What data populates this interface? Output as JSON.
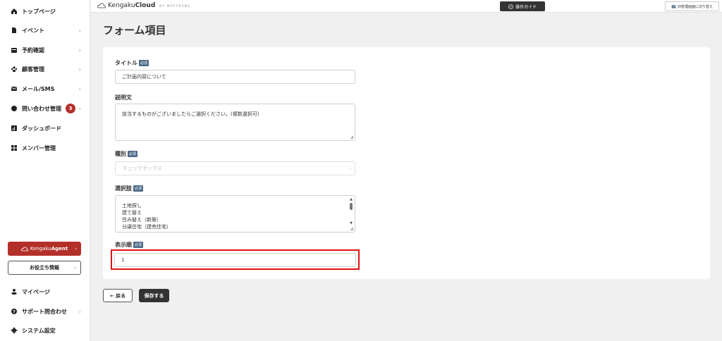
{
  "sidebar": {
    "items": [
      {
        "label": "トップページ",
        "icon": "home-icon",
        "chevron": false
      },
      {
        "label": "イベント",
        "icon": "document-icon",
        "chevron": true
      },
      {
        "label": "予約確認",
        "icon": "calendar-icon",
        "chevron": true
      },
      {
        "label": "顧客管理",
        "icon": "users-icon",
        "chevron": true
      },
      {
        "label": "メール/SMS",
        "icon": "mail-icon",
        "chevron": true
      },
      {
        "label": "問い合わせ管理",
        "icon": "chat-icon",
        "chevron": true,
        "badge": "3"
      },
      {
        "label": "ダッシュボード",
        "icon": "chart-icon",
        "chevron": false
      },
      {
        "label": "メンバー管理",
        "icon": "grid-icon",
        "chevron": false
      }
    ],
    "agent_button": {
      "brand_light": "Kengaku",
      "brand_bold": "Agent"
    },
    "info_button": "お役立ち情報",
    "bottom_items": [
      {
        "label": "マイページ",
        "icon": "person-icon",
        "chevron": false
      },
      {
        "label": "サポート問合わせ",
        "icon": "help-icon",
        "chevron": true
      },
      {
        "label": "システム設定",
        "icon": "gear-icon",
        "chevron": false
      }
    ]
  },
  "header": {
    "logo_light": "Kengaku",
    "logo_bold": "Cloud",
    "logo_tag": "BY MAYFRAME",
    "guide_button": "操作ガイド",
    "switch_button": "旧管理画面に切り替え"
  },
  "page": {
    "title": "フォーム項目"
  },
  "form": {
    "required_badge": "必須",
    "title_label": "タイトル",
    "title_value": "ご計画内容について",
    "description_label": "説明文",
    "description_value": "該当するものがございましたらご選択ください。(複数選択可)",
    "type_label": "種別",
    "type_value": "チェックボックス",
    "options_label": "選択肢",
    "options": [
      "土地探し",
      "建て替え",
      "住み替え（新築）",
      "分譲住宅（建売住宅）"
    ],
    "order_label": "表示順",
    "order_value": "1"
  },
  "actions": {
    "back": "← 戻る",
    "save": "保存する"
  },
  "colors": {
    "accent": "#b3302a",
    "dark": "#333333",
    "required": "#4c6a87",
    "highlight": "#e01212"
  }
}
